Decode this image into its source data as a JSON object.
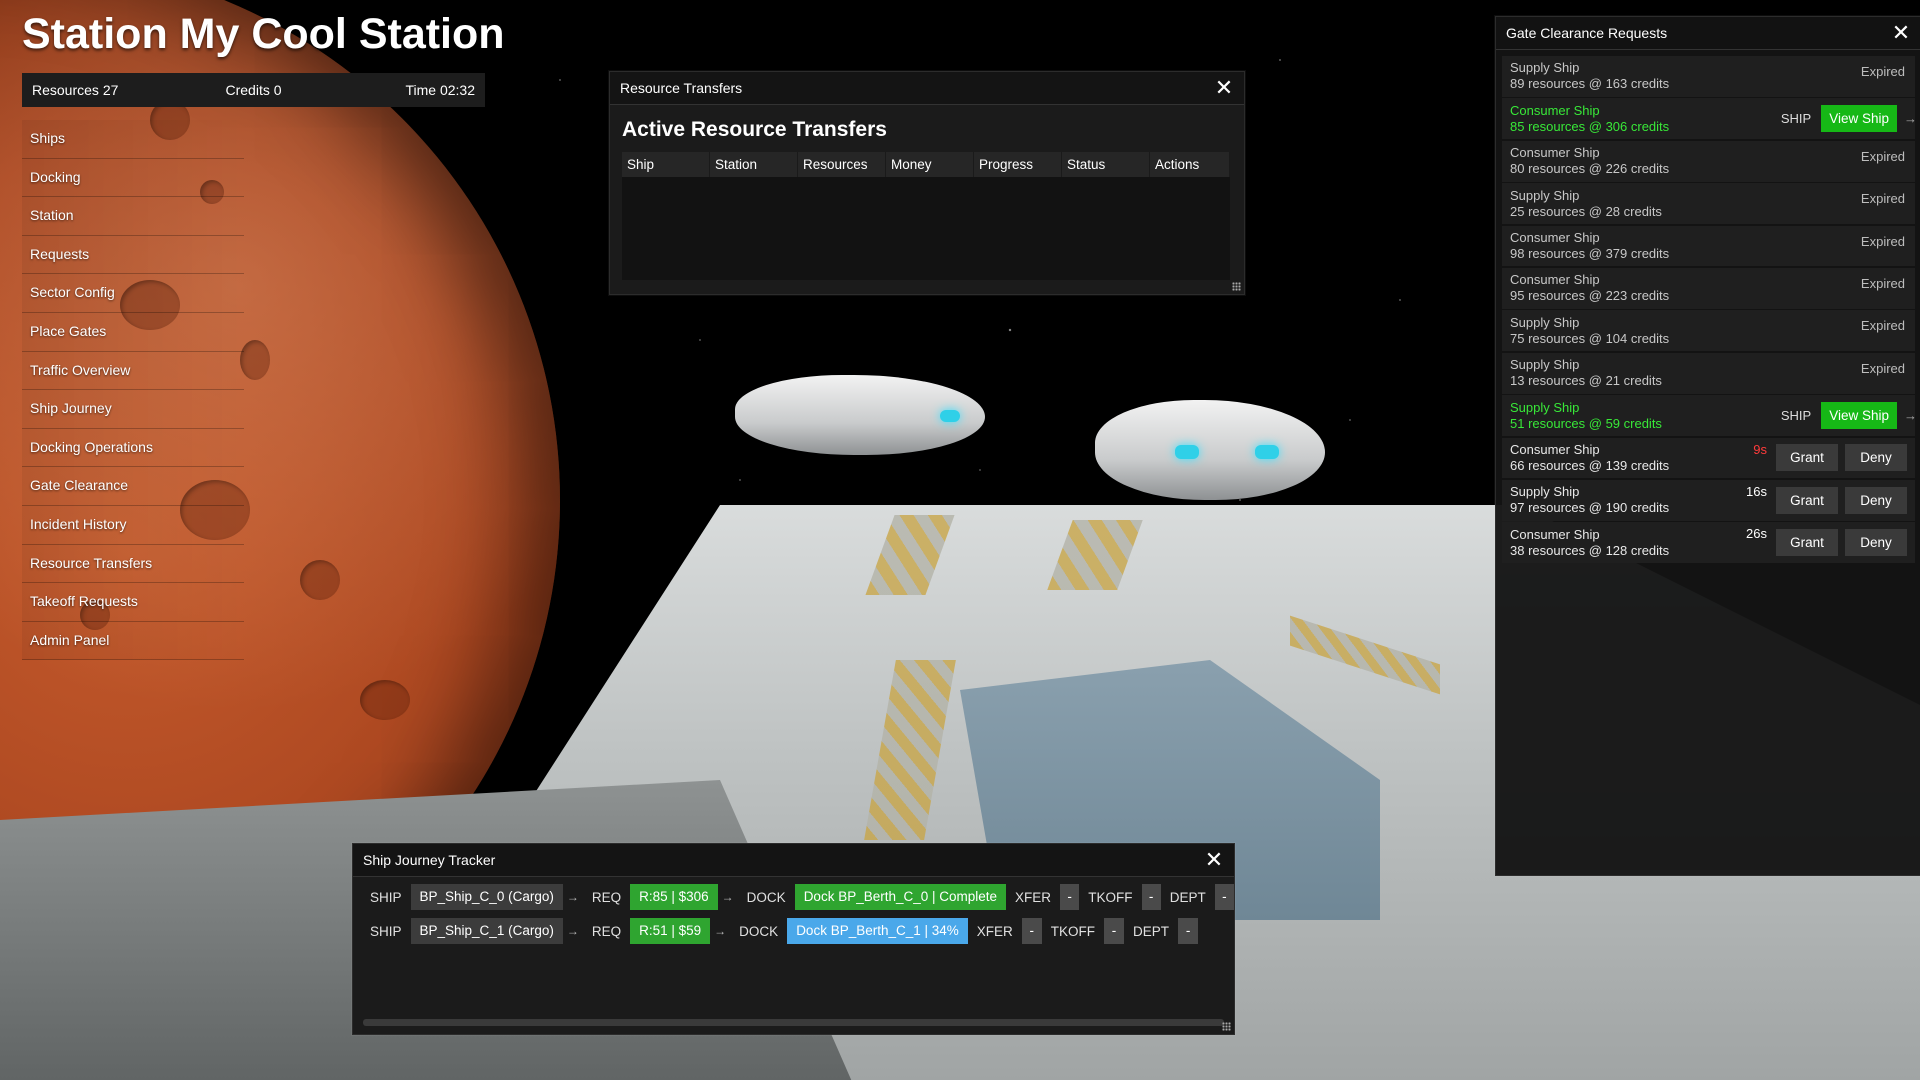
{
  "title": "Station My Cool Station",
  "hud": {
    "resources_label": "Resources",
    "resources_value": "27",
    "credits_label": "Credits",
    "credits_value": "0",
    "time_label": "Time",
    "time_value": "02:32"
  },
  "nav": {
    "items": [
      "Ships",
      "Docking",
      "Station",
      "Requests",
      "Sector Config",
      "Place Gates",
      "Traffic Overview",
      "Ship Journey",
      "Docking Operations",
      "Gate Clearance",
      "Incident History",
      "Resource Transfers",
      "Takeoff Requests",
      "Admin Panel"
    ]
  },
  "resource_transfers": {
    "window_title": "Resource Transfers",
    "heading": "Active Resource Transfers",
    "columns": [
      "Ship",
      "Station",
      "Resources",
      "Money",
      "Progress",
      "Status",
      "Actions"
    ],
    "close_glyph": "✕"
  },
  "gate_clearance": {
    "window_title": "Gate Clearance Requests",
    "close_glyph": "✕",
    "ship_label": "SHIP",
    "view_label": "View Ship",
    "grant_label": "Grant",
    "deny_label": "Deny",
    "arrow_glyph": "→",
    "requests": [
      {
        "ship": "Supply Ship",
        "detail": "89 resources @ 163 credits",
        "state": "expired",
        "status": "Expired"
      },
      {
        "ship": "Consumer Ship",
        "detail": "85 resources @ 306 credits",
        "state": "granted"
      },
      {
        "ship": "Consumer Ship",
        "detail": "80 resources @ 226 credits",
        "state": "expired",
        "status": "Expired"
      },
      {
        "ship": "Supply Ship",
        "detail": "25 resources @ 28 credits",
        "state": "expired",
        "status": "Expired"
      },
      {
        "ship": "Consumer Ship",
        "detail": "98 resources @ 379 credits",
        "state": "expired",
        "status": "Expired"
      },
      {
        "ship": "Consumer Ship",
        "detail": "95 resources @ 223 credits",
        "state": "expired",
        "status": "Expired"
      },
      {
        "ship": "Supply Ship",
        "detail": "75 resources @ 104 credits",
        "state": "expired",
        "status": "Expired"
      },
      {
        "ship": "Supply Ship",
        "detail": "13 resources @ 21 credits",
        "state": "expired",
        "status": "Expired"
      },
      {
        "ship": "Supply Ship",
        "detail": "51 resources @ 59 credits",
        "state": "granted"
      },
      {
        "ship": "Consumer Ship",
        "detail": "66 resources @ 139 credits",
        "state": "pending",
        "timer": "9s",
        "timer_color": "red"
      },
      {
        "ship": "Supply Ship",
        "detail": "97 resources @ 190 credits",
        "state": "pending",
        "timer": "16s",
        "timer_color": "white"
      },
      {
        "ship": "Consumer Ship",
        "detail": "38 resources @ 128 credits",
        "state": "pending",
        "timer": "26s",
        "timer_color": "white"
      }
    ]
  },
  "journey": {
    "window_title": "Ship Journey Tracker",
    "close_glyph": "✕",
    "labels": {
      "ship": "SHIP",
      "req": "REQ",
      "dock": "DOCK",
      "xfer": "XFER",
      "tkoff": "TKOFF",
      "dept": "DEPT"
    },
    "arrow_glyph": "→",
    "rows": [
      {
        "ship": "BP_Ship_C_0 (Cargo)",
        "req": "R:85 | $306",
        "dock": "Dock BP_Berth_C_0 | Complete",
        "dock_color": "green",
        "xfer": "-",
        "tkoff": "-",
        "dept": "-"
      },
      {
        "ship": "BP_Ship_C_1 (Cargo)",
        "req": "R:51 | $59",
        "dock": "Dock BP_Berth_C_1 | 34%",
        "dock_color": "blue",
        "xfer": "-",
        "tkoff": "-",
        "dept": "-"
      }
    ]
  },
  "colors": {
    "accent_green": "#16b816",
    "text_green": "#38e838",
    "timer_red": "#ff3b3b",
    "dock_progress_blue": "#4aa8ea"
  }
}
